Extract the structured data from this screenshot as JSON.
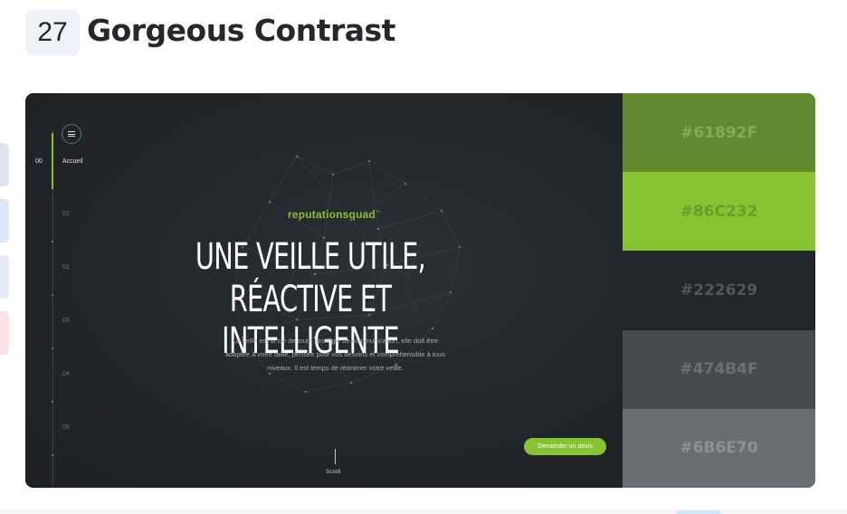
{
  "header": {
    "number": "27",
    "title": "Gorgeous Contrast"
  },
  "site": {
    "nav": {
      "active_number": "00",
      "active_label": "Accueil",
      "items": [
        "01",
        "02",
        "03",
        "04",
        "05"
      ]
    },
    "brand": "reputationsquad",
    "brand_mark": "™",
    "hero_line1": "UNE VEILLE UTILE,",
    "hero_line2": "RÉACTIVE ET INTELLIGENTE",
    "hero_text_1": "La veille est la clé de toute stratégie de communication, elle doit être",
    "hero_text_2": "adaptée à votre taille, pensée pour vos besoins et compréhensible à tous",
    "hero_text_3": "niveaux. Il est temps de réanimer votre veille.",
    "cta_label": "Demander un devis",
    "scroll_label": "Scroll"
  },
  "palette": [
    {
      "hex": "#61892F",
      "text_color": "#84a95a"
    },
    {
      "hex": "#86C232",
      "text_color": "#6a9c2a"
    },
    {
      "hex": "#222629",
      "text_color": "#51565b"
    },
    {
      "hex": "#474B4F",
      "text_color": "#6c7075"
    },
    {
      "hex": "#6B6E70",
      "text_color": "#8d9092"
    }
  ]
}
